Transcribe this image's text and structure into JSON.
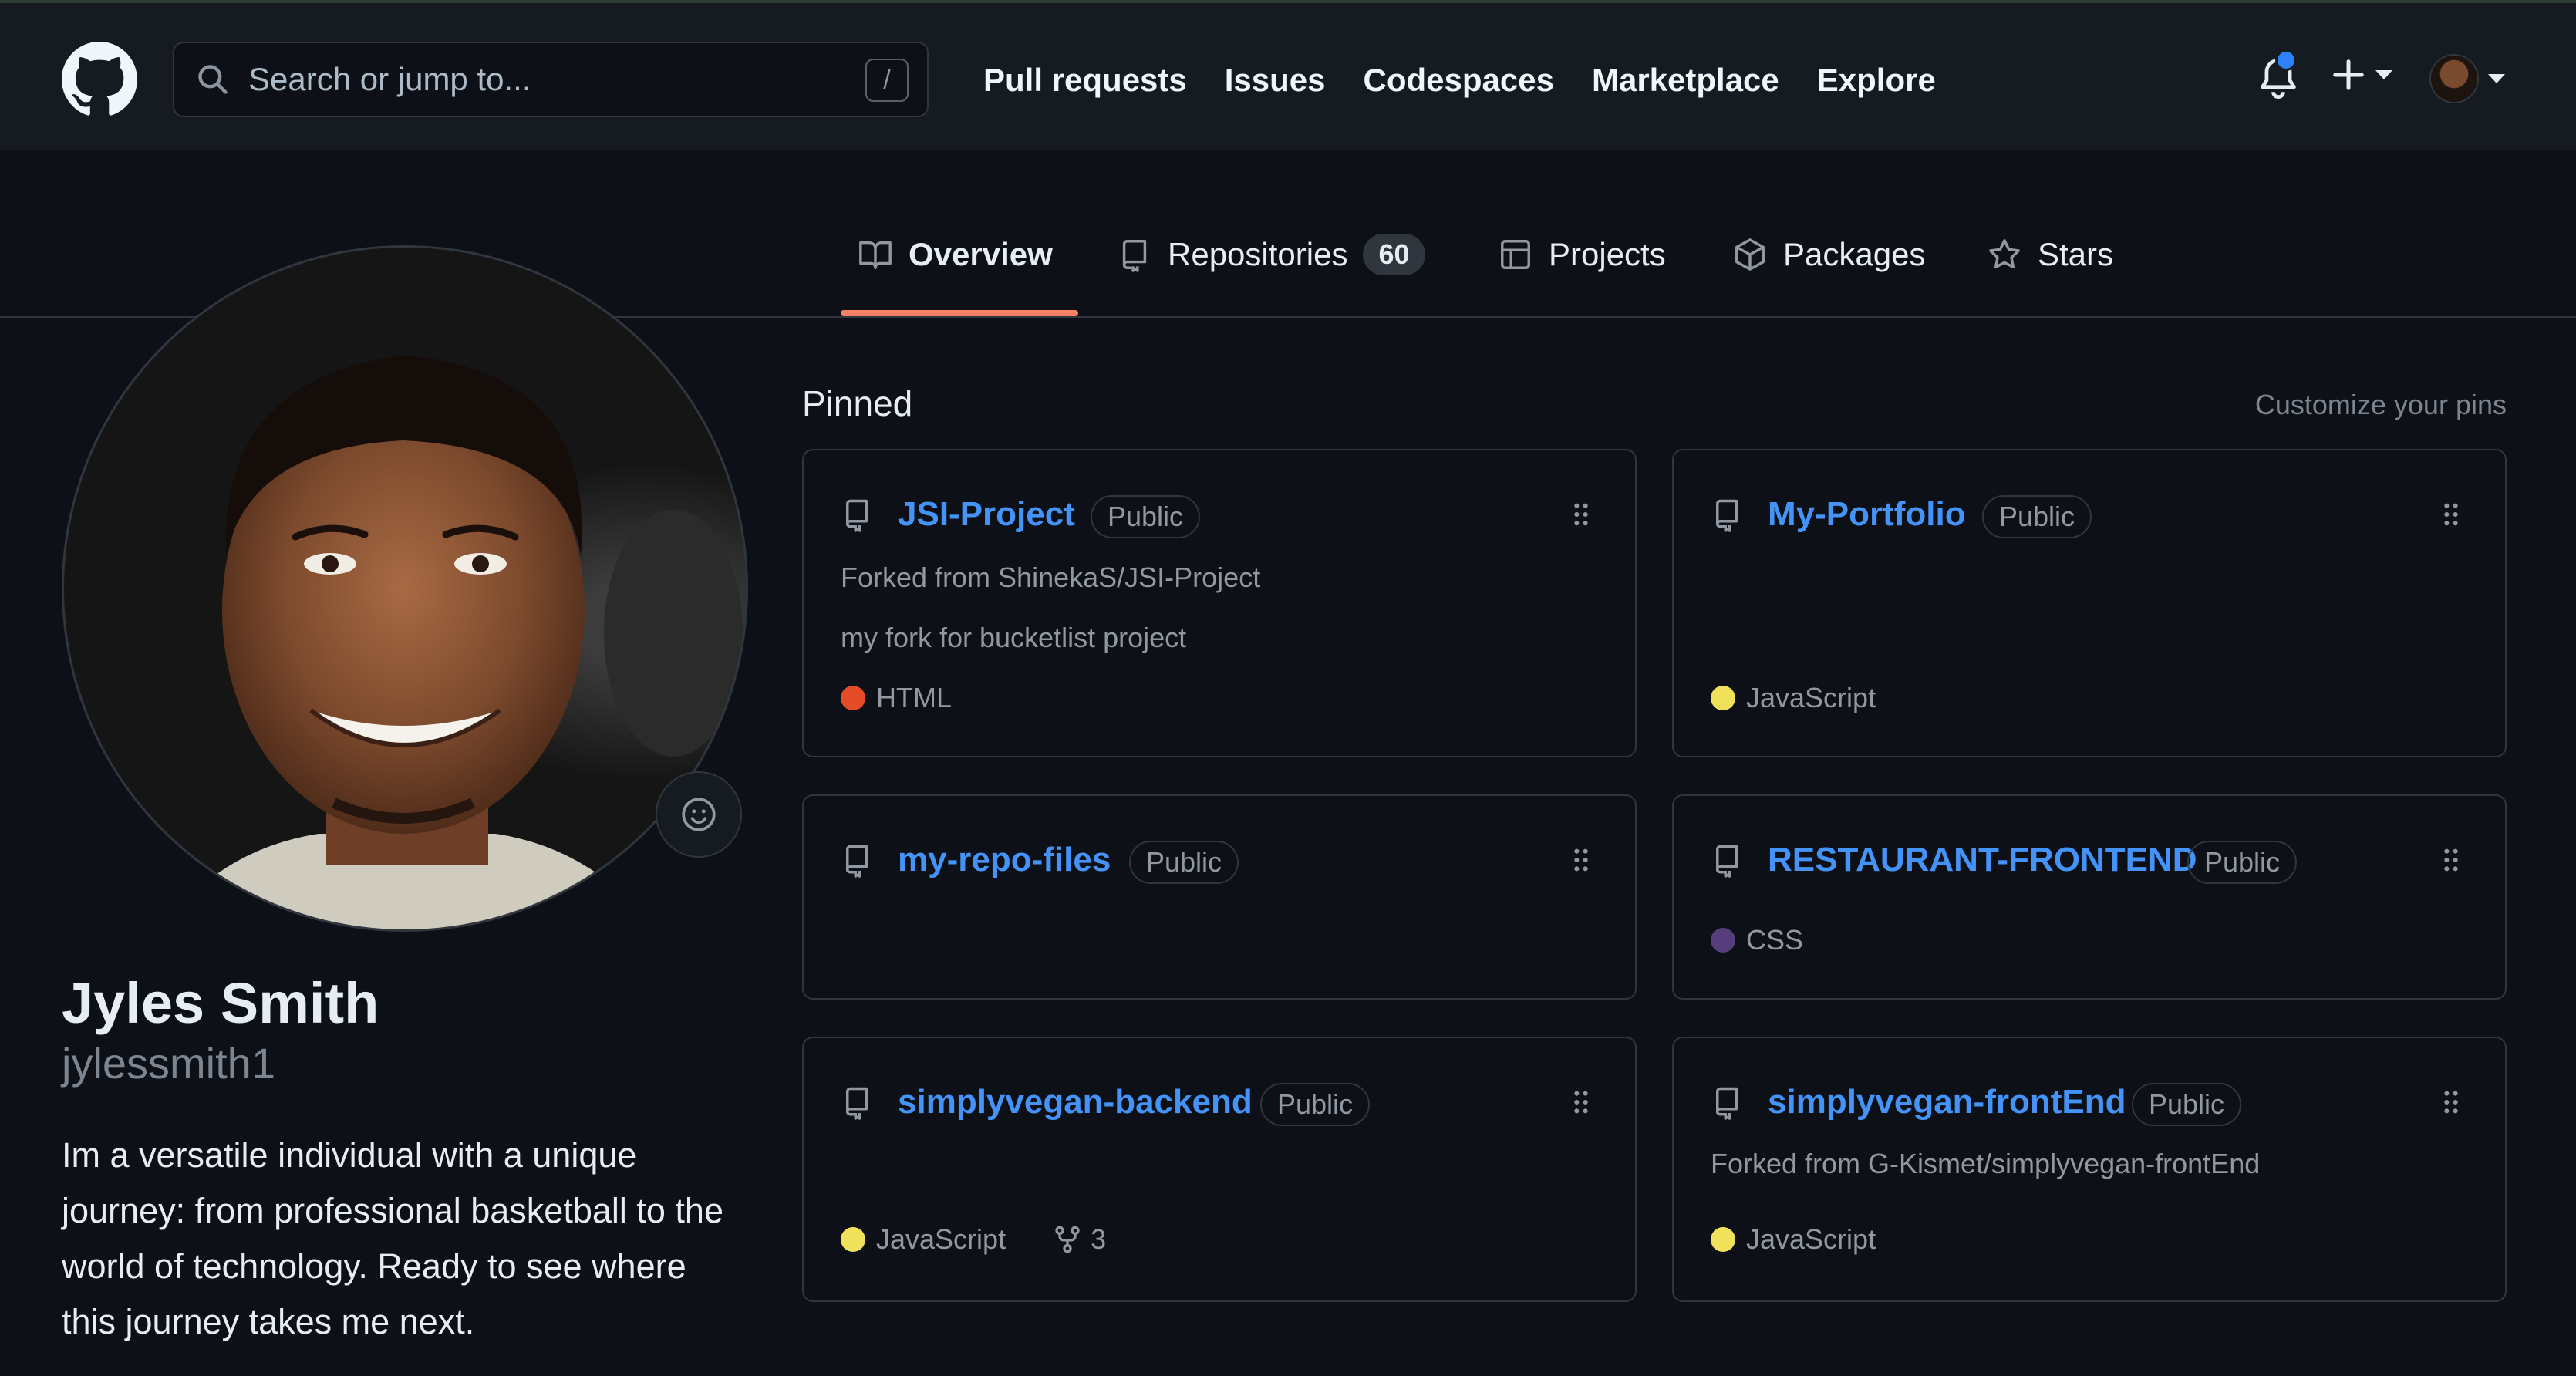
{
  "header": {
    "search_placeholder": "Search or jump to...",
    "search_shortcut": "/",
    "nav": [
      "Pull requests",
      "Issues",
      "Codespaces",
      "Marketplace",
      "Explore"
    ]
  },
  "tabs": {
    "overview": "Overview",
    "repositories": "Repositories",
    "repositories_count": "60",
    "projects": "Projects",
    "packages": "Packages",
    "stars": "Stars"
  },
  "profile": {
    "name": "Jyles Smith",
    "username": "jylessmith1",
    "bio": "Im a versatile individual with a unique journey: from professional basketball to the world of technology. Ready to see where this journey takes me next."
  },
  "pinned": {
    "title": "Pinned",
    "customize": "Customize your pins",
    "repos": [
      {
        "name": "JSI-Project",
        "visibility": "Public",
        "forked_from": "Forked from ShinekaS/JSI-Project",
        "description": "my fork for bucketlist project",
        "language": "HTML",
        "language_color": "#e34c26"
      },
      {
        "name": "My-Portfolio",
        "visibility": "Public",
        "language": "JavaScript",
        "language_color": "#f1e05a"
      },
      {
        "name": "my-repo-files",
        "visibility": "Public"
      },
      {
        "name": "RESTAURANT-FRONTEND",
        "visibility": "Public",
        "language": "CSS",
        "language_color": "#563d7c"
      },
      {
        "name": "simplyvegan-backend",
        "visibility": "Public",
        "language": "JavaScript",
        "language_color": "#f1e05a",
        "forks": "3"
      },
      {
        "name": "simplyvegan-frontEnd",
        "visibility": "Public",
        "forked_from": "Forked from G-Kismet/simplyvegan-frontEnd",
        "language": "JavaScript",
        "language_color": "#f1e05a"
      }
    ]
  },
  "colors": {
    "accent_link": "#4493f8",
    "tab_underline": "#f78166",
    "notification_dot": "#2f81f7"
  }
}
